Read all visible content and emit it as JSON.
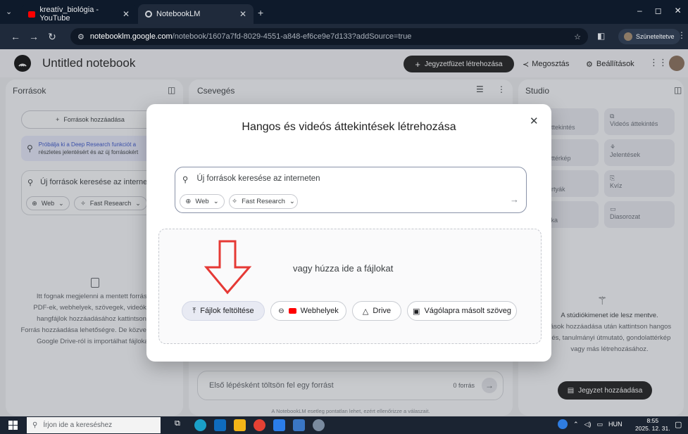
{
  "browser": {
    "tabs": [
      {
        "title": "kreatív_biológia - YouTube",
        "active": false
      },
      {
        "title": "NotebookLM",
        "active": true
      }
    ],
    "url_host": "notebooklm.google.com",
    "url_path": "/notebook/1607a7fd-8029-4551-a848-ef6ce9e7d133?addSource=true",
    "profile_label": "Szüneteltetve"
  },
  "header": {
    "notebook_title": "Untitled notebook",
    "create_button": "Jegyzetfüzet létrehozása",
    "share_button": "Megosztás",
    "settings_button": "Beállítások"
  },
  "sources": {
    "title": "Források",
    "add_button": "Források hozzáadása",
    "promo_line1": "Próbálja ki a Deep Research funkciót a",
    "promo_line2": "részletes jelentésért és az új forrásokért",
    "search_placeholder": "Új források keresése az interneten",
    "web_label": "Web",
    "research_label": "Fast Research",
    "empty_lines": [
      "Itt fognak megjelenni a mentett forrásai",
      "PDF-ek, webhelyek, szövegek, videók és",
      "hangfájlok hozzáadásához kattintson a",
      "Forrás hozzáadása lehetőségre. De közvetlenül a",
      "Google Drive-ról is importálhat fájlokat."
    ]
  },
  "chat": {
    "title": "Csevegés",
    "input_placeholder": "Első lépésként töltsön fel egy forrást",
    "source_count": "0 forrás",
    "disclaimer": "A NotebookLM esetleg pontatlan lehet, ezért ellenőrizze a válaszait."
  },
  "studio": {
    "title": "Studio",
    "tiles": [
      {
        "label": "áttekintés",
        "icon": "audio-icon"
      },
      {
        "label": "Videós áttekintés",
        "icon": "video-icon"
      },
      {
        "label": "attérkép",
        "icon": "map-icon"
      },
      {
        "label": "Jelentések",
        "icon": "report-icon"
      },
      {
        "label": "ártyák",
        "icon": "cards-icon"
      },
      {
        "label": "Kvíz",
        "icon": "quiz-icon"
      },
      {
        "label": "fika",
        "icon": "infographic-icon"
      },
      {
        "label": "Diasorozat",
        "icon": "slides-icon"
      }
    ],
    "empty_lines": [
      "A stúdiókimenet ide lesz mentve.",
      "rások hozzáadása után kattintson hangos",
      "zés, tanulmányi útmutató, gondolattérkép",
      "vagy más létrehozásához."
    ],
    "add_note_button": "Jegyzet hozzáadása"
  },
  "modal": {
    "title": "Hangos és videós áttekintések létrehozása",
    "search_placeholder": "Új források keresése az interneten",
    "web_label": "Web",
    "research_label": "Fast Research",
    "drop_text": "vagy húzza ide a fájlokat",
    "buttons": {
      "upload": "Fájlok feltöltése",
      "websites": "Webhelyek",
      "drive": "Drive",
      "clipboard": "Vágólapra másolt szöveg"
    }
  },
  "taskbar": {
    "search_placeholder": "Írjon ide a kereséshez",
    "language": "HUN",
    "time": "8:55",
    "date": "2025. 12. 31."
  },
  "colors": {
    "accent_red": "#e53935",
    "dark_button": "#1f1f1f",
    "modal_border": "#8a93a8"
  }
}
